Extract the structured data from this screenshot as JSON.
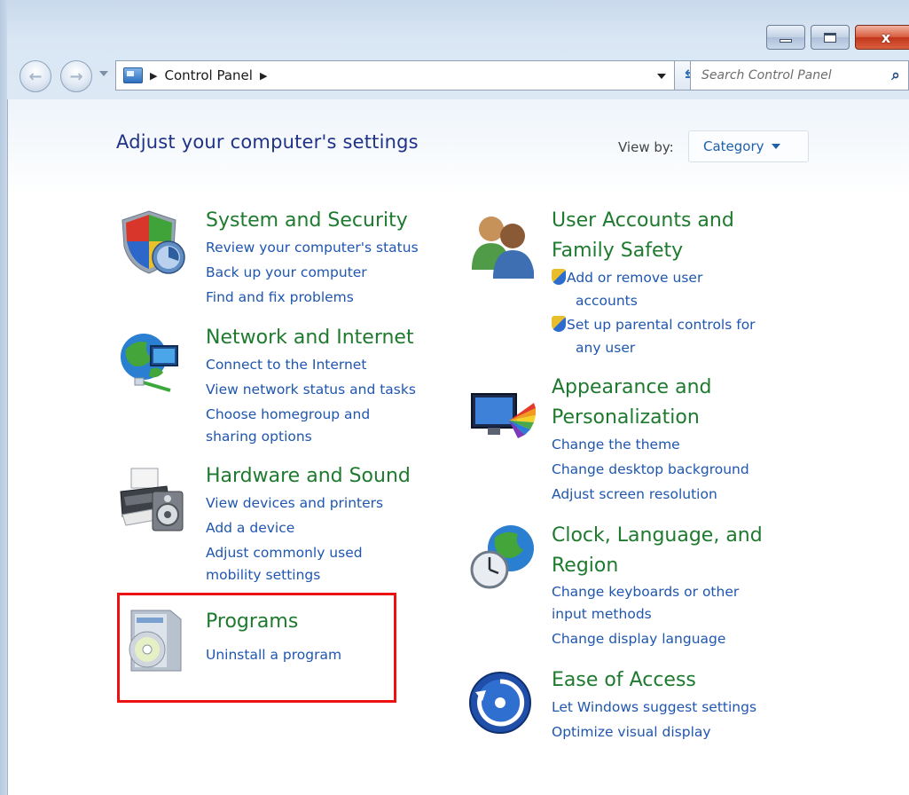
{
  "window": {
    "close_glyph": "x"
  },
  "nav": {
    "back_glyph": "←",
    "forward_glyph": "→"
  },
  "address": {
    "arrow": "▶",
    "crumb": "Control Panel",
    "refresh_glyph": "⇆"
  },
  "search": {
    "placeholder": "Search Control Panel",
    "icon_glyph": "⌕"
  },
  "page": {
    "title": "Adjust your computer's settings",
    "view_by_label": "View by:",
    "view_by_value": "Category"
  },
  "categories": {
    "system": {
      "title": "System and Security",
      "links": [
        "Review your computer's status",
        "Back up your computer",
        "Find and fix problems"
      ]
    },
    "network": {
      "title": "Network and Internet",
      "links": [
        "Connect to the Internet",
        "View network status and tasks",
        "Choose homegroup and",
        "sharing options"
      ]
    },
    "hardware": {
      "title": "Hardware and Sound",
      "links": [
        "View devices and printers",
        "Add a device",
        "Adjust commonly used",
        "mobility settings"
      ]
    },
    "programs": {
      "title": "Programs",
      "links": [
        "Uninstall a program"
      ]
    },
    "users": {
      "title_line1": "User Accounts and",
      "title_line2": "Family Safety",
      "links": [
        "Add or remove user",
        "accounts",
        "Set up parental controls for",
        "any user"
      ]
    },
    "appearance": {
      "title_line1": "Appearance and",
      "title_line2": "Personalization",
      "links": [
        "Change the theme",
        "Change desktop background",
        "Adjust screen resolution"
      ]
    },
    "clock": {
      "title_line1": "Clock, Language, and",
      "title_line2": "Region",
      "links": [
        "Change keyboards or other",
        "input methods",
        "Change display language"
      ]
    },
    "ease": {
      "title": "Ease of Access",
      "links": [
        "Let Windows suggest settings",
        "Optimize visual display"
      ]
    }
  },
  "colors": {
    "category_title": "#1e7a2e",
    "link": "#1f56b0",
    "heading": "#1e3287",
    "highlight": "#ee1111"
  }
}
